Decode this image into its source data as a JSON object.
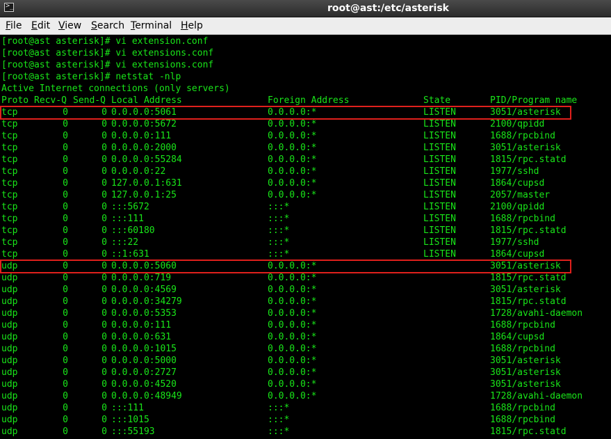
{
  "window": {
    "title": "root@ast:/etc/asterisk",
    "icon": "terminal-icon"
  },
  "menu": [
    {
      "id": "file",
      "label": "File",
      "mnemonic": "F",
      "rest": "ile"
    },
    {
      "id": "edit",
      "label": "Edit",
      "mnemonic": "E",
      "rest": "dit"
    },
    {
      "id": "view",
      "label": "View",
      "mnemonic": "V",
      "rest": "iew"
    },
    {
      "id": "search",
      "label": "Search",
      "mnemonic": "S",
      "rest": "earch"
    },
    {
      "id": "terminal",
      "label": "Terminal",
      "mnemonic": "T",
      "rest": "erminal"
    },
    {
      "id": "help",
      "label": "Help",
      "mnemonic": "H",
      "rest": "elp"
    }
  ],
  "prompt_lines": [
    "[root@ast asterisk]# vi extension.conf",
    "[root@ast asterisk]# vi extensions.conf",
    "[root@ast asterisk]# vi extensions.conf",
    "[root@ast asterisk]# netstat -nlp"
  ],
  "section_header": "Active Internet connections (only servers)",
  "columns": [
    "Proto",
    "Recv-Q",
    "Send-Q",
    "Local Address",
    "Foreign Address",
    "State",
    "PID/Program name"
  ],
  "rows": [
    {
      "proto": "tcp",
      "recvq": "0",
      "sendq": "0",
      "local": "0.0.0.0:5061",
      "foreign": "0.0.0.0:*",
      "state": "LISTEN",
      "pid": "3051/asterisk",
      "highlighted": true
    },
    {
      "proto": "tcp",
      "recvq": "0",
      "sendq": "0",
      "local": "0.0.0.0:5672",
      "foreign": "0.0.0.0:*",
      "state": "LISTEN",
      "pid": "2100/qpidd",
      "highlighted": false
    },
    {
      "proto": "tcp",
      "recvq": "0",
      "sendq": "0",
      "local": "0.0.0.0:111",
      "foreign": "0.0.0.0:*",
      "state": "LISTEN",
      "pid": "1688/rpcbind",
      "highlighted": false
    },
    {
      "proto": "tcp",
      "recvq": "0",
      "sendq": "0",
      "local": "0.0.0.0:2000",
      "foreign": "0.0.0.0:*",
      "state": "LISTEN",
      "pid": "3051/asterisk",
      "highlighted": false
    },
    {
      "proto": "tcp",
      "recvq": "0",
      "sendq": "0",
      "local": "0.0.0.0:55284",
      "foreign": "0.0.0.0:*",
      "state": "LISTEN",
      "pid": "1815/rpc.statd",
      "highlighted": false
    },
    {
      "proto": "tcp",
      "recvq": "0",
      "sendq": "0",
      "local": "0.0.0.0:22",
      "foreign": "0.0.0.0:*",
      "state": "LISTEN",
      "pid": "1977/sshd",
      "highlighted": false
    },
    {
      "proto": "tcp",
      "recvq": "0",
      "sendq": "0",
      "local": "127.0.0.1:631",
      "foreign": "0.0.0.0:*",
      "state": "LISTEN",
      "pid": "1864/cupsd",
      "highlighted": false
    },
    {
      "proto": "tcp",
      "recvq": "0",
      "sendq": "0",
      "local": "127.0.0.1:25",
      "foreign": "0.0.0.0:*",
      "state": "LISTEN",
      "pid": "2057/master",
      "highlighted": false
    },
    {
      "proto": "tcp",
      "recvq": "0",
      "sendq": "0",
      "local": ":::5672",
      "foreign": ":::*",
      "state": "LISTEN",
      "pid": "2100/qpidd",
      "highlighted": false
    },
    {
      "proto": "tcp",
      "recvq": "0",
      "sendq": "0",
      "local": ":::111",
      "foreign": ":::*",
      "state": "LISTEN",
      "pid": "1688/rpcbind",
      "highlighted": false
    },
    {
      "proto": "tcp",
      "recvq": "0",
      "sendq": "0",
      "local": ":::60180",
      "foreign": ":::*",
      "state": "LISTEN",
      "pid": "1815/rpc.statd",
      "highlighted": false
    },
    {
      "proto": "tcp",
      "recvq": "0",
      "sendq": "0",
      "local": ":::22",
      "foreign": ":::*",
      "state": "LISTEN",
      "pid": "1977/sshd",
      "highlighted": false
    },
    {
      "proto": "tcp",
      "recvq": "0",
      "sendq": "0",
      "local": "::1:631",
      "foreign": ":::*",
      "state": "LISTEN",
      "pid": "1864/cupsd",
      "highlighted": false
    },
    {
      "proto": "udp",
      "recvq": "0",
      "sendq": "0",
      "local": "0.0.0.0:5060",
      "foreign": "0.0.0.0:*",
      "state": "",
      "pid": "3051/asterisk",
      "highlighted": true
    },
    {
      "proto": "udp",
      "recvq": "0",
      "sendq": "0",
      "local": "0.0.0.0:719",
      "foreign": "0.0.0.0:*",
      "state": "",
      "pid": "1815/rpc.statd",
      "highlighted": false
    },
    {
      "proto": "udp",
      "recvq": "0",
      "sendq": "0",
      "local": "0.0.0.0:4569",
      "foreign": "0.0.0.0:*",
      "state": "",
      "pid": "3051/asterisk",
      "highlighted": false
    },
    {
      "proto": "udp",
      "recvq": "0",
      "sendq": "0",
      "local": "0.0.0.0:34279",
      "foreign": "0.0.0.0:*",
      "state": "",
      "pid": "1815/rpc.statd",
      "highlighted": false
    },
    {
      "proto": "udp",
      "recvq": "0",
      "sendq": "0",
      "local": "0.0.0.0:5353",
      "foreign": "0.0.0.0:*",
      "state": "",
      "pid": "1728/avahi-daemon",
      "highlighted": false
    },
    {
      "proto": "udp",
      "recvq": "0",
      "sendq": "0",
      "local": "0.0.0.0:111",
      "foreign": "0.0.0.0:*",
      "state": "",
      "pid": "1688/rpcbind",
      "highlighted": false
    },
    {
      "proto": "udp",
      "recvq": "0",
      "sendq": "0",
      "local": "0.0.0.0:631",
      "foreign": "0.0.0.0:*",
      "state": "",
      "pid": "1864/cupsd",
      "highlighted": false
    },
    {
      "proto": "udp",
      "recvq": "0",
      "sendq": "0",
      "local": "0.0.0.0:1015",
      "foreign": "0.0.0.0:*",
      "state": "",
      "pid": "1688/rpcbind",
      "highlighted": false
    },
    {
      "proto": "udp",
      "recvq": "0",
      "sendq": "0",
      "local": "0.0.0.0:5000",
      "foreign": "0.0.0.0:*",
      "state": "",
      "pid": "3051/asterisk",
      "highlighted": false
    },
    {
      "proto": "udp",
      "recvq": "0",
      "sendq": "0",
      "local": "0.0.0.0:2727",
      "foreign": "0.0.0.0:*",
      "state": "",
      "pid": "3051/asterisk",
      "highlighted": false
    },
    {
      "proto": "udp",
      "recvq": "0",
      "sendq": "0",
      "local": "0.0.0.0:4520",
      "foreign": "0.0.0.0:*",
      "state": "",
      "pid": "3051/asterisk",
      "highlighted": false
    },
    {
      "proto": "udp",
      "recvq": "0",
      "sendq": "0",
      "local": "0.0.0.0:48949",
      "foreign": "0.0.0.0:*",
      "state": "",
      "pid": "1728/avahi-daemon",
      "highlighted": false
    },
    {
      "proto": "udp",
      "recvq": "0",
      "sendq": "0",
      "local": ":::111",
      "foreign": ":::*",
      "state": "",
      "pid": "1688/rpcbind",
      "highlighted": false
    },
    {
      "proto": "udp",
      "recvq": "0",
      "sendq": "0",
      "local": ":::1015",
      "foreign": ":::*",
      "state": "",
      "pid": "1688/rpcbind",
      "highlighted": false
    },
    {
      "proto": "udp",
      "recvq": "0",
      "sendq": "0",
      "local": ":::55193",
      "foreign": ":::*",
      "state": "",
      "pid": "1815/rpc.statd",
      "highlighted": false
    }
  ],
  "colors": {
    "terminal_fg": "#19e619",
    "terminal_bg": "#000000",
    "highlight_box": "#e0201c",
    "menubar_bg": "#ededed"
  }
}
